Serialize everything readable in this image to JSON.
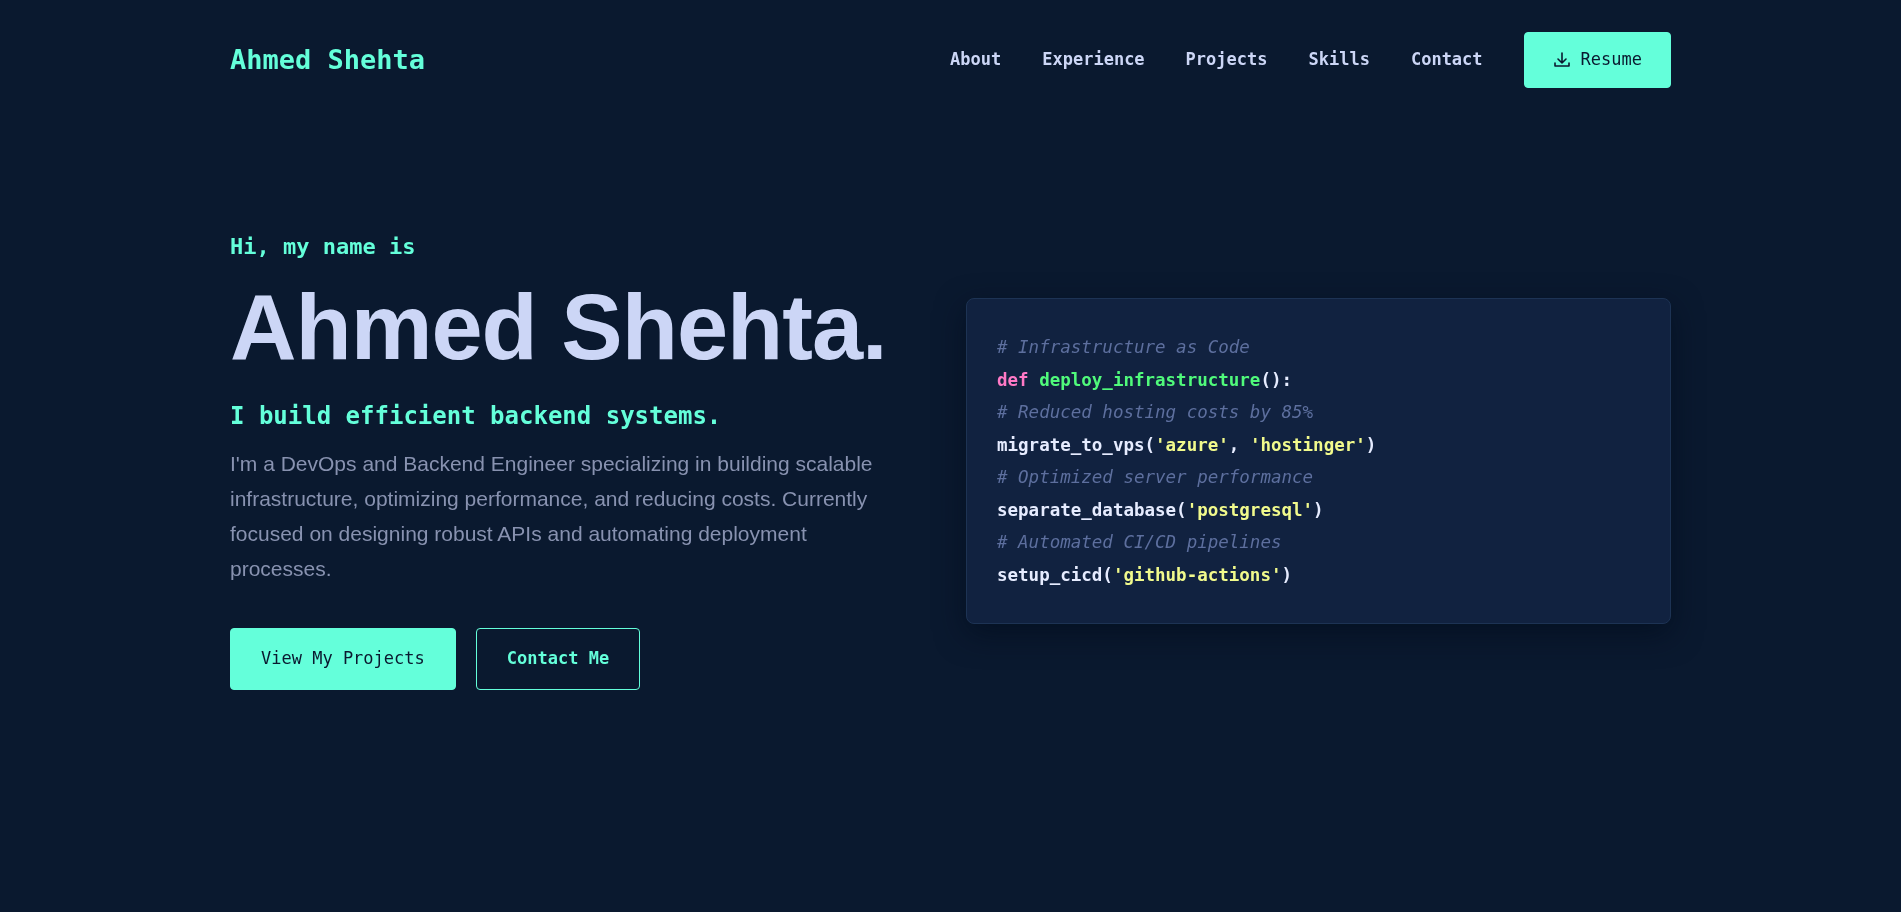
{
  "navbar": {
    "logo": "Ahmed Shehta",
    "links": [
      {
        "label": "About"
      },
      {
        "label": "Experience"
      },
      {
        "label": "Projects"
      },
      {
        "label": "Skills"
      },
      {
        "label": "Contact"
      }
    ],
    "resume_button": "Resume"
  },
  "hero": {
    "greeting": "Hi, my name is",
    "name": "Ahmed Shehta.",
    "tagline": "I build efficient backend systems.",
    "description": "I'm a DevOps and Backend Engineer specializing in building scalable infrastructure, optimizing performance, and reducing costs. Currently focused on designing robust APIs and automating deployment processes.",
    "buttons": [
      {
        "label": "View My Projects",
        "kind": "primary"
      },
      {
        "label": "Contact Me",
        "kind": "outline"
      }
    ]
  },
  "code_card": {
    "lines": [
      [
        {
          "kind": "comment",
          "text": "# Infrastructure as Code"
        }
      ],
      [
        {
          "kind": "keyword",
          "text": "def "
        },
        {
          "kind": "function",
          "text": "deploy_infrastructure"
        },
        {
          "kind": "plain",
          "text": "():"
        }
      ],
      [
        {
          "kind": "comment",
          "text": "# Reduced hosting costs by 85%"
        }
      ],
      [
        {
          "kind": "plain",
          "text": "migrate_to_vps("
        },
        {
          "kind": "string",
          "text": "'azure'"
        },
        {
          "kind": "plain",
          "text": ", "
        },
        {
          "kind": "string",
          "text": "'hostinger'"
        },
        {
          "kind": "plain",
          "text": ")"
        }
      ],
      [
        {
          "kind": "comment",
          "text": "# Optimized server performance"
        }
      ],
      [
        {
          "kind": "plain",
          "text": "separate_database("
        },
        {
          "kind": "string",
          "text": "'postgresql'"
        },
        {
          "kind": "plain",
          "text": ")"
        }
      ],
      [
        {
          "kind": "comment",
          "text": "# Automated CI/CD pipelines"
        }
      ],
      [
        {
          "kind": "plain",
          "text": "setup_cicd("
        },
        {
          "kind": "string",
          "text": "'github-actions'"
        },
        {
          "kind": "plain",
          "text": ")"
        }
      ]
    ]
  }
}
